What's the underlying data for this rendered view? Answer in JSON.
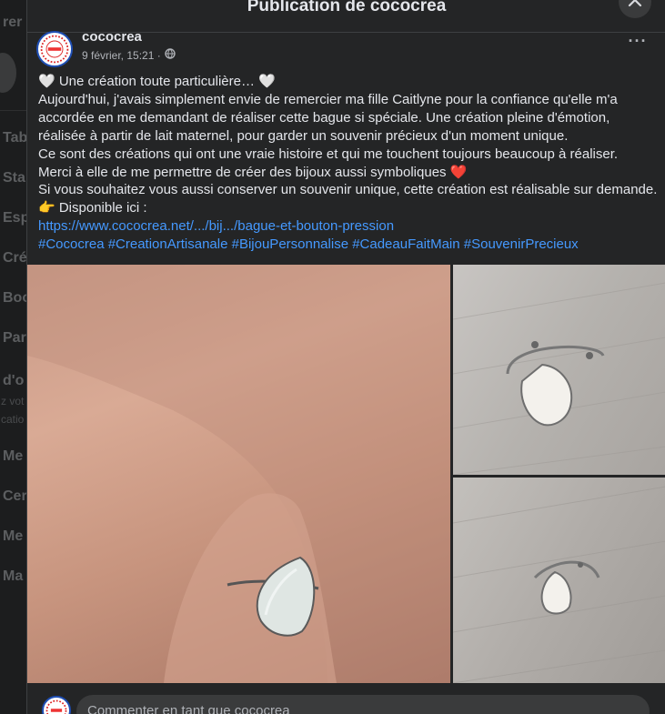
{
  "background": {
    "items": [
      "rer",
      "Tab",
      "Sta",
      "Esp",
      "Cré",
      "Boo",
      "Par",
      "d'o",
      "z vot",
      "catio",
      "Me",
      "Cer",
      "Me",
      "Ma"
    ]
  },
  "modal": {
    "title": "Publication de cococrea",
    "close_icon": "close-icon"
  },
  "post": {
    "author": "cococrea",
    "date": "9 février, 15:21 ·",
    "privacy_icon": "globe-icon",
    "more_label": "···",
    "lines": [
      "🤍 Une création toute particulière… 🤍",
      "Aujourd'hui, j'avais simplement envie de remercier ma fille Caitlyne pour la confiance qu'elle m'a",
      "accordée en me demandant de réaliser cette bague si spéciale. Une création pleine d'émotion,",
      "réalisée à partir de lait maternel, pour garder un souvenir précieux d'un moment unique.",
      "Ce sont des créations qui ont une vraie histoire et qui me touchent toujours beaucoup à réaliser.",
      "Merci à elle de me permettre de créer des bijoux aussi symboliques ❤️",
      "Si vous souhaitez vous aussi conserver un souvenir unique, cette création est réalisable sur demande.",
      "👉 Disponible ici :"
    ],
    "link": "https://www.cococrea.net/.../bij.../bague-et-bouton-pression",
    "hashtags": "#Cococrea #CreationArtisanale #BijouPersonnalise #CadeauFaitMain #SouvenirPrecieux"
  },
  "comment": {
    "placeholder": "Commenter en tant que cococrea"
  },
  "colors": {
    "modal_bg": "#242526",
    "text": "#e4e6eb",
    "link": "#4599ff",
    "secondary": "#b0b3b8"
  }
}
